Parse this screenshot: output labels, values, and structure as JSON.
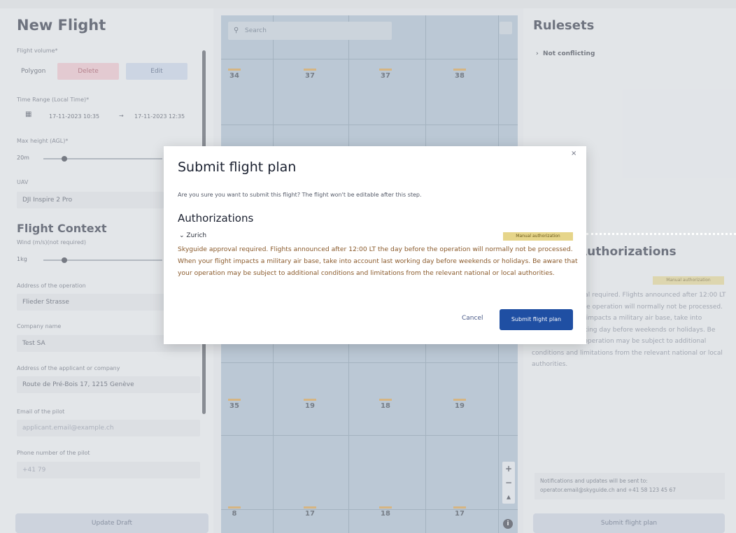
{
  "left": {
    "title": "New Flight",
    "flight_volume_label": "Flight volume*",
    "polygon_label": "Polygon",
    "delete_label": "Delete",
    "edit_label": "Edit",
    "time_range_label": "Time Range (Local Time)*",
    "time_from": "17-11-2023 10:35",
    "time_sep": "→",
    "time_to": "17-11-2023 12:35",
    "max_height_label": "Max height (AGL)*",
    "max_height_value": "20m",
    "uav_label": "UAV",
    "uav_value": "DJI Inspire 2 Pro",
    "context_title": "Flight Context",
    "min_wind_label": "Wind (m/s)(not required)",
    "min_wind_value": "1kg",
    "pilot_address_label": "Address of the operation",
    "pilot_address_value": "Flieder Strasse",
    "company_label": "Company name",
    "company_value": "Test SA",
    "address_label": "Address of the applicant or company",
    "address_value": "Route de Pré-Bois 17, 1215 Genève",
    "email_label": "Email of the pilot",
    "email_value": "applicant.email@example.ch",
    "phone_label": "Phone number of the pilot",
    "phone_value": "+41 79",
    "update_button": "Update Draft"
  },
  "map": {
    "search_placeholder": "Search",
    "altitudes_top": [
      "34",
      "37",
      "37",
      "38"
    ],
    "altitudes_mid": [
      "35",
      "19",
      "18",
      "19"
    ],
    "altitudes_bottom": [
      "8",
      "17",
      "18",
      "17"
    ],
    "zoom_in": "+",
    "zoom_out": "−",
    "compass": "▴",
    "info": "i"
  },
  "right": {
    "rulesets_title": "Rulesets",
    "ruleset_item": "Not conflicting",
    "authorizations_title": "Authorizations",
    "auth_badge": "Manual authorization",
    "auth_text": "Skyguide approval required. Flights announced after 12:00 LT the day before the operation will normally not be processed. When your flight impacts a military air base, take into account last working day before weekends or holidays. Be aware that your operation may be subject to additional conditions and limitations from the relevant national or local authorities.",
    "contact_text": "Notifications and updates will be sent to: operator.email@skyguide.ch and +41 58 123 45 67",
    "submit_button": "Submit flight plan"
  },
  "modal": {
    "close": "×",
    "title": "Submit flight plan",
    "subtitle": "Are you sure you want to submit this flight? The flight won't be editable after this step.",
    "authorizations": "Authorizations",
    "zurich": "Zurich",
    "badge": "Manual authorization",
    "text": "Skyguide approval required. Flights announced after 12:00 LT the day before the operation will normally not be processed. When your flight impacts a military air base, take into account last working day before weekends or holidays. Be aware that your operation may be subject to additional conditions and limitations from the relevant national or local authorities.",
    "cancel": "Cancel",
    "submit": "Submit flight plan"
  }
}
